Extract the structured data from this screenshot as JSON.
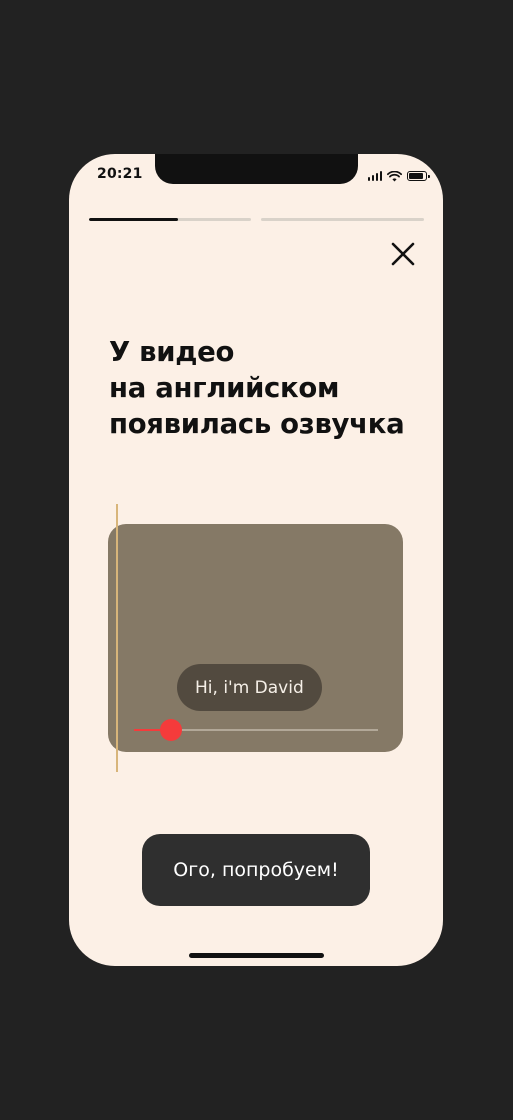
{
  "status_bar": {
    "time": "20:21",
    "battery_level": 0.9
  },
  "stories_progress": [
    {
      "progress": 0.55
    },
    {
      "progress": 0
    }
  ],
  "close_icon": "close-icon",
  "headline": {
    "lines": [
      "У видео",
      "на английском",
      "появилась озвучка"
    ]
  },
  "video_preview": {
    "subtitle": "Hi, i'm David",
    "playback_progress": 0.15,
    "colors": {
      "card": "#857966",
      "seek_accent": "#F53B3B",
      "timeline_marker": "#D8B57A"
    }
  },
  "cta": {
    "label": "Ого, попробуем!"
  },
  "colors": {
    "screen_background": "#FCF0E6",
    "outer_background": "#222222",
    "button": "#2F2F2F"
  }
}
